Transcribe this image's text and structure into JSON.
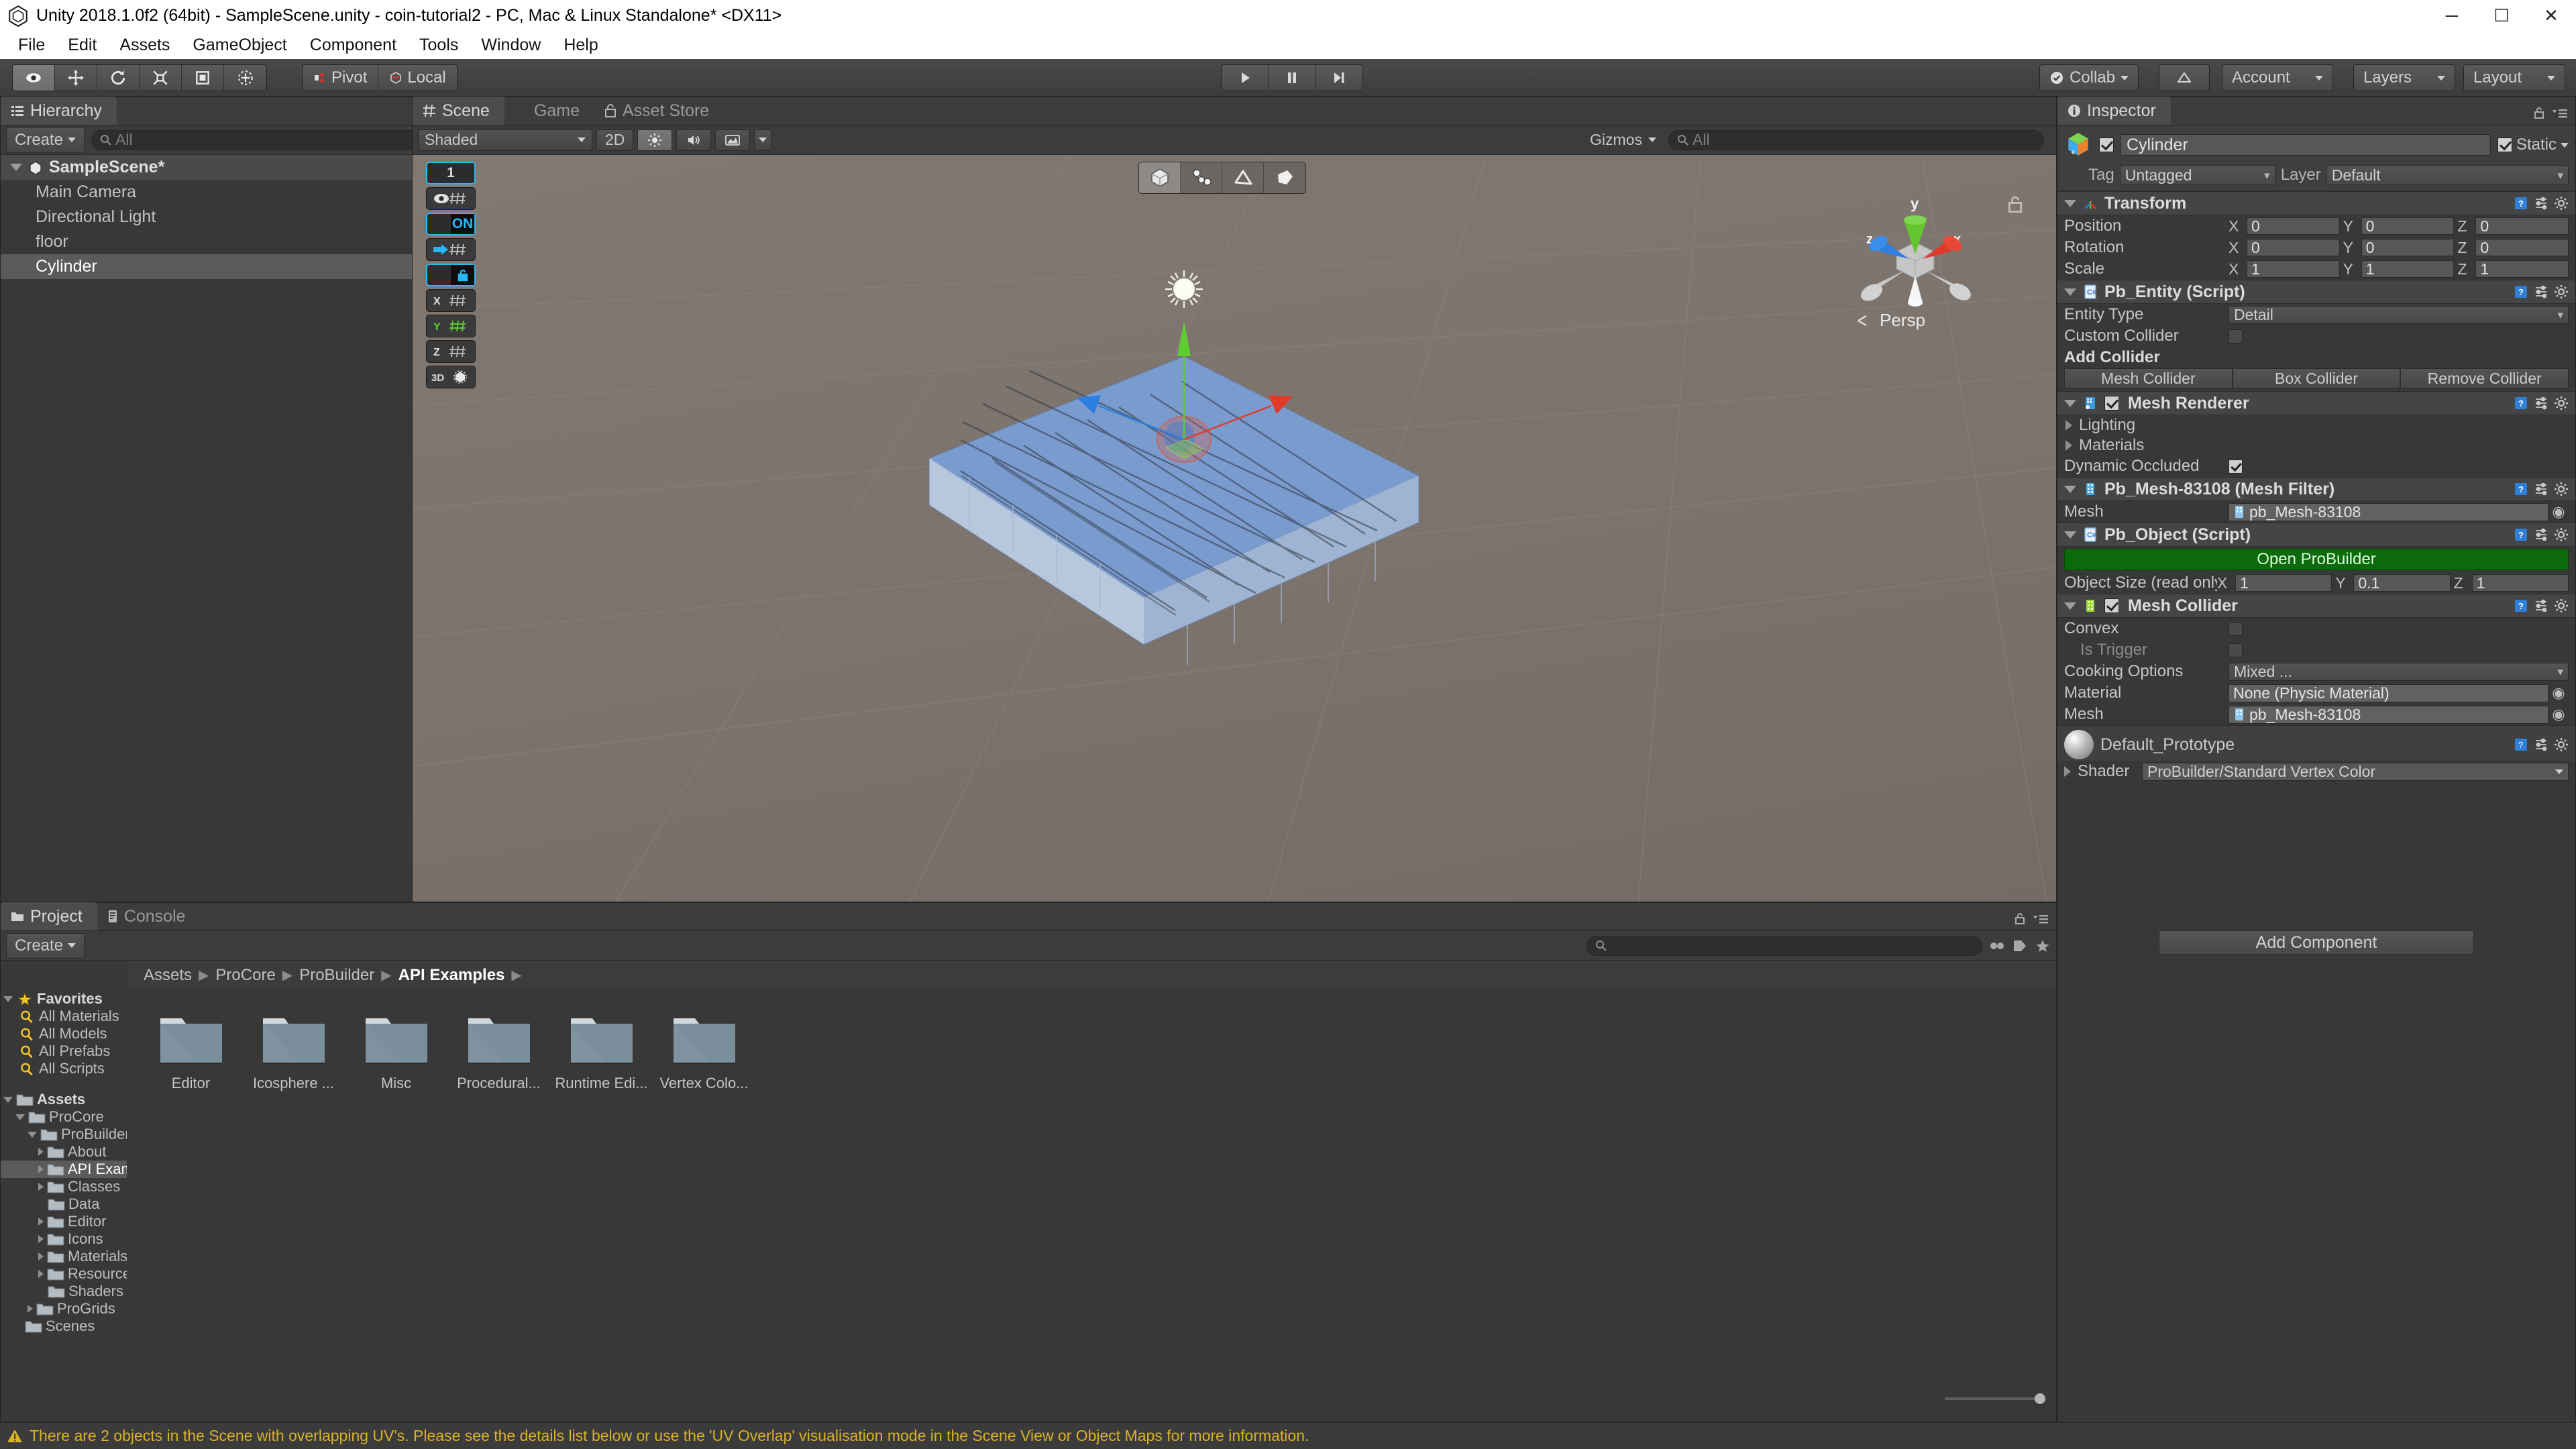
{
  "window": {
    "title": "Unity 2018.1.0f2 (64bit) - SampleScene.unity - coin-tutorial2 - PC, Mac & Linux Standalone* <DX11>",
    "minimize": "─",
    "maximize": "☐",
    "close": "✕"
  },
  "menubar": {
    "items": [
      {
        "label": "File"
      },
      {
        "label": "Edit"
      },
      {
        "label": "Assets"
      },
      {
        "label": "GameObject"
      },
      {
        "label": "Component"
      },
      {
        "label": "Tools"
      },
      {
        "label": "Window"
      },
      {
        "label": "Help"
      }
    ]
  },
  "toolbar": {
    "transform_tools": [
      {
        "name": "hand-tool",
        "selected": true
      },
      {
        "name": "move-tool",
        "selected": false
      },
      {
        "name": "rotate-tool",
        "selected": false
      },
      {
        "name": "scale-tool",
        "selected": false
      },
      {
        "name": "rect-tool",
        "selected": false
      },
      {
        "name": "transform-tool",
        "selected": false
      }
    ],
    "pivot_label": "Pivot",
    "local_label": "Local",
    "play_label": "Play",
    "pause_label": "Pause",
    "step_label": "Step",
    "collab_label": "Collab",
    "cloud_label": "Services",
    "account_label": "Account",
    "layers_label": "Layers",
    "layout_label": "Layout"
  },
  "hierarchy": {
    "tab_label": "Hierarchy",
    "create_label": "Create",
    "search_placeholder": "All",
    "scene_name": "SampleScene*",
    "items": [
      {
        "label": "Main Camera",
        "selected": false
      },
      {
        "label": "Directional Light",
        "selected": false
      },
      {
        "label": "floor",
        "selected": false
      },
      {
        "label": "Cylinder",
        "selected": true
      }
    ]
  },
  "scene": {
    "tabs": [
      {
        "label": "Scene",
        "active": true,
        "icon": "grid-icon"
      },
      {
        "label": "Game",
        "active": false,
        "icon": "gamepad-icon"
      },
      {
        "label": "Asset Store",
        "active": false,
        "icon": "store-icon"
      }
    ],
    "draw_mode": "Shaded",
    "twod_label": "2D",
    "lighting_toggle": "lighting-icon",
    "audio_toggle": "audio-icon",
    "fx_toggle": "fx-icon",
    "gizmos_label": "Gizmos",
    "search_placeholder": "All",
    "progrids": [
      {
        "label": "1",
        "type": "value"
      },
      {
        "label": "",
        "type": "visibility"
      },
      {
        "label": "ON",
        "type": "snap"
      },
      {
        "label": "",
        "type": "push"
      },
      {
        "label": "",
        "type": "lock"
      },
      {
        "label": "X",
        "type": "axis"
      },
      {
        "label": "Y",
        "type": "axis",
        "active": true
      },
      {
        "label": "Z",
        "type": "axis"
      },
      {
        "label": "3D",
        "type": "perspective"
      }
    ],
    "pb_modes": [
      {
        "name": "object-mode",
        "selected": true
      },
      {
        "name": "vertex-mode",
        "selected": false
      },
      {
        "name": "edge-mode",
        "selected": false
      },
      {
        "name": "face-mode",
        "selected": false
      }
    ],
    "gizmo": {
      "x_label": "x",
      "y_label": "y",
      "z_label": "z",
      "projection_label": "Persp"
    }
  },
  "inspector": {
    "tab_label": "Inspector",
    "object_name": "Cylinder",
    "object_enabled": true,
    "static_label": "Static",
    "static_checked": true,
    "tag_label": "Tag",
    "tag_value": "Untagged",
    "layer_label": "Layer",
    "layer_value": "Default",
    "transform": {
      "title": "Transform",
      "rows": [
        {
          "label": "Position",
          "x": "0",
          "y": "0",
          "z": "0"
        },
        {
          "label": "Rotation",
          "x": "0",
          "y": "0",
          "z": "0"
        },
        {
          "label": "Scale",
          "x": "1",
          "y": "1",
          "z": "1"
        }
      ]
    },
    "pb_entity": {
      "title": "Pb_Entity (Script)",
      "entity_type_label": "Entity Type",
      "entity_type_value": "Detail",
      "custom_collider_label": "Custom Collider",
      "custom_collider_checked": false,
      "add_collider_label": "Add Collider",
      "buttons": [
        "Mesh Collider",
        "Box Collider",
        "Remove Collider"
      ]
    },
    "mesh_renderer": {
      "title": "Mesh Renderer",
      "enabled": true,
      "lighting_label": "Lighting",
      "materials_label": "Materials",
      "dynamic_occluded_label": "Dynamic Occluded",
      "dynamic_occluded_checked": true
    },
    "mesh_filter": {
      "title": "Pb_Mesh-83108 (Mesh Filter)",
      "mesh_label": "Mesh",
      "mesh_value": "pb_Mesh-83108"
    },
    "pb_object": {
      "title": "Pb_Object (Script)",
      "open_button": "Open ProBuilder",
      "size_label": "Object Size (read only)",
      "size_x": "1",
      "size_y": "0.1",
      "size_z": "1"
    },
    "mesh_collider": {
      "title": "Mesh Collider",
      "enabled": true,
      "convex_label": "Convex",
      "convex_checked": false,
      "is_trigger_label": "Is Trigger",
      "is_trigger_checked": false,
      "cooking_label": "Cooking Options",
      "cooking_value": "Mixed ...",
      "material_label": "Material",
      "material_value": "None (Physic Material)",
      "mesh_label": "Mesh",
      "mesh_value": "pb_Mesh-83108"
    },
    "material": {
      "title": "Default_Prototype",
      "shader_label": "Shader",
      "shader_value": "ProBuilder/Standard Vertex Color"
    },
    "add_component_label": "Add Component"
  },
  "project": {
    "tabs": [
      {
        "label": "Project",
        "active": true,
        "icon": "folder-icon"
      },
      {
        "label": "Console",
        "active": false,
        "icon": "console-icon"
      }
    ],
    "create_label": "Create",
    "search_placeholder": "",
    "breadcrumb": [
      "Assets",
      "ProCore",
      "ProBuilder",
      "API Examples"
    ],
    "favorites": {
      "label": "Favorites",
      "items": [
        "All Materials",
        "All Models",
        "All Prefabs",
        "All Scripts"
      ]
    },
    "tree": [
      {
        "label": "Assets",
        "depth": 0,
        "state": "open",
        "bold": true
      },
      {
        "label": "ProCore",
        "depth": 1,
        "state": "open"
      },
      {
        "label": "ProBuilder",
        "depth": 2,
        "state": "open"
      },
      {
        "label": "About",
        "depth": 3,
        "state": "closed"
      },
      {
        "label": "API Examples",
        "depth": 3,
        "state": "closed",
        "selected": true
      },
      {
        "label": "Classes",
        "depth": 3,
        "state": "closed"
      },
      {
        "label": "Data",
        "depth": 3,
        "state": "leaf"
      },
      {
        "label": "Editor",
        "depth": 3,
        "state": "closed"
      },
      {
        "label": "Icons",
        "depth": 3,
        "state": "closed"
      },
      {
        "label": "Materials",
        "depth": 3,
        "state": "closed"
      },
      {
        "label": "Resources",
        "depth": 3,
        "state": "closed"
      },
      {
        "label": "Shaders",
        "depth": 3,
        "state": "leaf"
      },
      {
        "label": "ProGrids",
        "depth": 2,
        "state": "closed"
      },
      {
        "label": "Scenes",
        "depth": 1,
        "state": "leaf"
      }
    ],
    "assets": [
      {
        "label": "Editor",
        "type": "folder"
      },
      {
        "label": "Icosphere ...",
        "type": "folder"
      },
      {
        "label": "Misc",
        "type": "folder"
      },
      {
        "label": "Procedural...",
        "type": "folder"
      },
      {
        "label": "Runtime Edi...",
        "type": "folder"
      },
      {
        "label": "Vertex Colo...",
        "type": "folder"
      }
    ]
  },
  "statusbar": {
    "message": "There are 2 objects in the Scene with overlapping UV's. Please see the details list below or use the 'UV Overlap' visualisation mode in the Scene View or Object Maps for more information.",
    "icon": "warning-icon"
  },
  "colors": {
    "accent_blue": "#29b6f6",
    "warning_yellow": "#d8b32a",
    "probuilder_green": "#0b6b0b",
    "axis_x": "#e03a2a",
    "axis_y": "#5ccf2f",
    "axis_z": "#2a7fe0",
    "mesh_blue": "#6f93c7",
    "scene_bg": "#7d736d",
    "panel_bg": "#383838"
  }
}
